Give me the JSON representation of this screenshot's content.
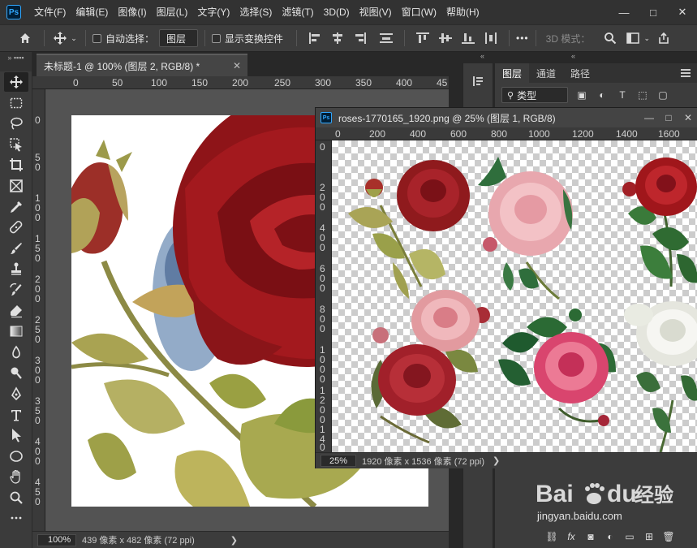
{
  "app": {
    "logo": "Ps"
  },
  "menu": [
    "文件(F)",
    "编辑(E)",
    "图像(I)",
    "图层(L)",
    "文字(Y)",
    "选择(S)",
    "滤镜(T)",
    "3D(D)",
    "视图(V)",
    "窗口(W)",
    "帮助(H)"
  ],
  "window_buttons": {
    "minimize": "—",
    "maximize": "□",
    "close": "✕"
  },
  "options": {
    "auto_select_label": "自动选择：",
    "auto_select_target": "图层",
    "show_transform_label": "显示变换控件",
    "mode_3d_label": "3D 模式：",
    "more": "•••"
  },
  "document1": {
    "tab_title": "未标题-1 @ 100% (图层 2, RGB/8) *",
    "tab_close": "✕",
    "ruler_h": [
      "0",
      "50",
      "100",
      "150",
      "200",
      "250",
      "300",
      "350",
      "400",
      "45"
    ],
    "ruler_v": [
      "0",
      "5",
      "0",
      "1",
      "0",
      "0",
      "1",
      "5",
      "0",
      "2",
      "0",
      "0",
      "2",
      "5",
      "0",
      "3",
      "0",
      "0",
      "3",
      "5",
      "0",
      "4",
      "0",
      "0",
      "4",
      "5",
      "0"
    ],
    "zoom": "100%",
    "info": "439 像素 x 482 像素 (72 ppi)",
    "arrow": "❯"
  },
  "document2": {
    "title": "roses-1770165_1920.png @ 25% (图层 1, RGB/8)",
    "ruler_h": [
      "0",
      "200",
      "400",
      "600",
      "800",
      "1000",
      "1200",
      "1400",
      "1600"
    ],
    "ruler_v": [
      "0",
      "2",
      "0",
      "0",
      "4",
      "0",
      "0",
      "6",
      "0",
      "0",
      "8",
      "0",
      "0",
      "1",
      "0",
      "0",
      "0",
      "1",
      "2",
      "0",
      "0",
      "1",
      "4",
      "0",
      "0"
    ],
    "zoom": "25%",
    "info": "1920 像素 x 1536 像素 (72 ppi)",
    "arrow": "❯",
    "buttons": {
      "minimize": "—",
      "maximize": "□",
      "close": "✕"
    }
  },
  "layers_panel": {
    "tabs": [
      "图层",
      "通道",
      "路径"
    ],
    "active_tab": 0,
    "filter_type": "类型"
  },
  "watermark": {
    "brand": "Bai",
    "brand2": "du",
    "cn": "经验",
    "url": "jingyan.baidu.com"
  },
  "colors": {
    "accent_ps": "#31a8ff",
    "canvas_bg": "#535353",
    "panel_bg": "#3c3c3c"
  }
}
